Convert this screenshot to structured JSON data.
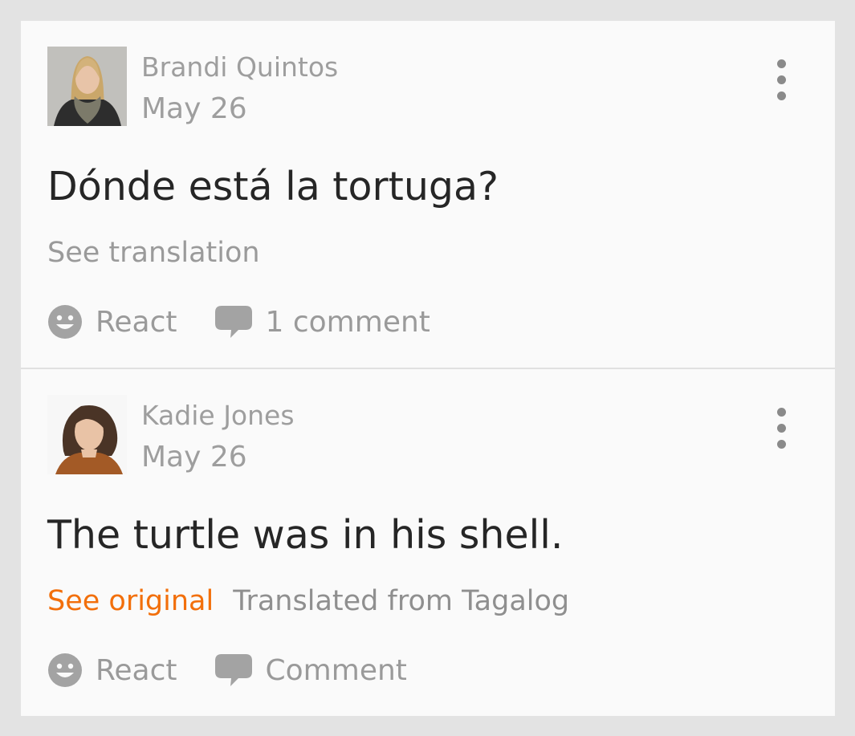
{
  "colors": {
    "accent": "#f26f0b",
    "muted_text": "#9e9e9e",
    "body_text": "#262626",
    "card_bg": "#fafafa",
    "page_bg": "#e3e3e3"
  },
  "posts": [
    {
      "author": "Brandi Quintos",
      "date": "May 26",
      "text": "Dónde está la tortuga?",
      "translation_link": "See translation",
      "actions": {
        "react_label": "React",
        "comment_label": "1 comment"
      },
      "icons": {
        "react": "smiley-icon",
        "comment": "speech-bubble-icon",
        "menu": "more-vert-icon"
      }
    },
    {
      "author": "Kadie Jones",
      "date": "May 26",
      "text": "The turtle was in his shell.",
      "translation_link": "See original",
      "translated_from": "Translated from Tagalog",
      "actions": {
        "react_label": "React",
        "comment_label": "Comment"
      },
      "icons": {
        "react": "smiley-icon",
        "comment": "speech-bubble-icon",
        "menu": "more-vert-icon"
      }
    }
  ]
}
